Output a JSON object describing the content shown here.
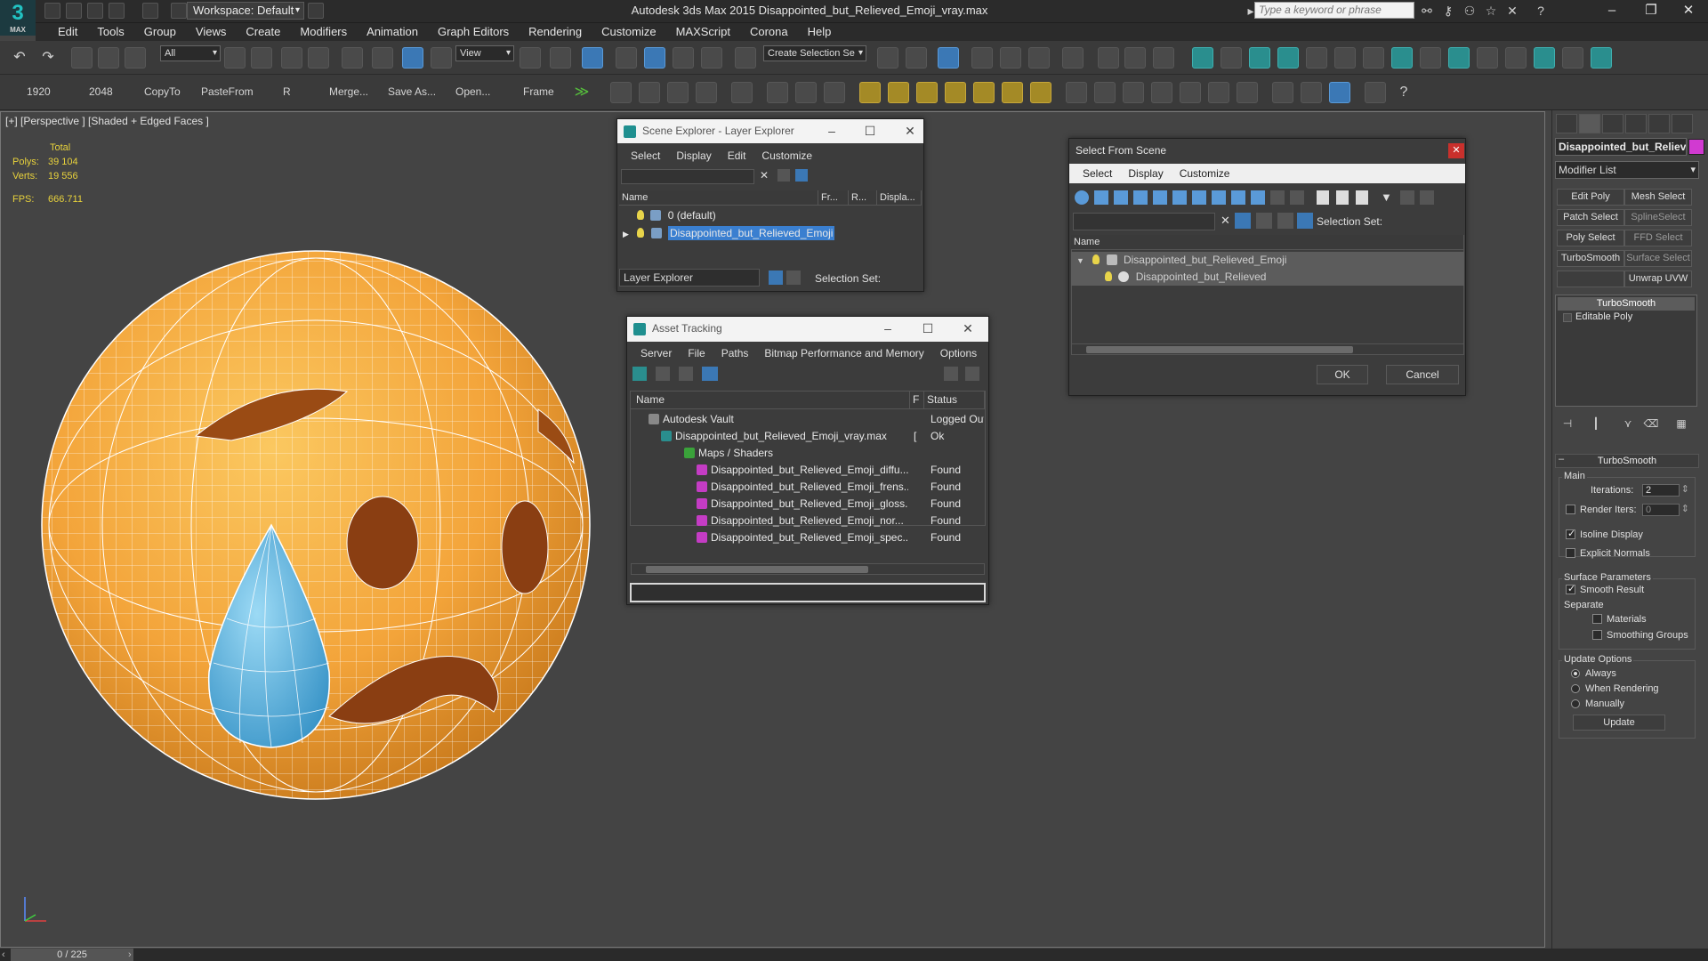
{
  "app": {
    "logo": "3",
    "logo_sub": "MAX",
    "window_title": "Autodesk 3ds Max  2015    Disappointed_but_Relieved_Emoji_vray.max",
    "workspace": "Workspace: Default",
    "search_placeholder": "Type a keyword or phrase"
  },
  "menu": [
    "Edit",
    "Tools",
    "Group",
    "Views",
    "Create",
    "Modifiers",
    "Animation",
    "Graph Editors",
    "Rendering",
    "Customize",
    "MAXScript",
    "Corona",
    "Help"
  ],
  "toolbar1": {
    "selection_filter": "All",
    "ref_coord": "View",
    "named_selection": "Create Selection Se"
  },
  "toolbar2": {
    "buttons": [
      "1920",
      "2048",
      "CopyTo",
      "PasteFrom",
      "R",
      "Merge...",
      "Save As...",
      "Open...",
      "Frame"
    ]
  },
  "viewport": {
    "label": "[+] [Perspective ] [Shaded + Edged Faces ]",
    "stats": {
      "header": "Total",
      "polys_label": "Polys:",
      "polys": "39 104",
      "verts_label": "Verts:",
      "verts": "19 556",
      "fps_label": "FPS:",
      "fps": "666.711"
    },
    "colors": {
      "emoji": "#f3a43a",
      "tear": "#5cb6e0",
      "wire": "#ffffff"
    }
  },
  "timeline": {
    "frame": "0 / 225"
  },
  "scene_explorer": {
    "title": "Scene Explorer - Layer Explorer",
    "menu": [
      "Select",
      "Display",
      "Edit",
      "Customize"
    ],
    "columns": [
      "Name",
      "Fr...",
      "R...",
      "Displa..."
    ],
    "rows": [
      "0 (default)",
      "Disappointed_but_Relieved_Emoji"
    ],
    "footer_dropdown": "Layer Explorer",
    "selection_set_label": "Selection Set:"
  },
  "select_from_scene": {
    "title": "Select From Scene",
    "menu": [
      "Select",
      "Display",
      "Customize"
    ],
    "selection_set_label": "Selection Set:",
    "column_name": "Name",
    "rows": [
      "Disappointed_but_Relieved_Emoji",
      "Disappointed_but_Relieved"
    ],
    "ok": "OK",
    "cancel": "Cancel"
  },
  "asset_tracking": {
    "title": "Asset Tracking",
    "menu": [
      "Server",
      "File",
      "Paths",
      "Bitmap Performance and Memory",
      "Options"
    ],
    "columns": [
      "Name",
      "F",
      "Status"
    ],
    "rows": [
      {
        "name": "Autodesk Vault",
        "f": "",
        "status": "Logged Out"
      },
      {
        "name": "Disappointed_but_Relieved_Emoji_vray.max",
        "f": "[",
        "status": "Ok"
      },
      {
        "name": "Maps / Shaders",
        "f": "",
        "status": ""
      },
      {
        "name": "Disappointed_but_Relieved_Emoji_diffu...",
        "f": "",
        "status": "Found"
      },
      {
        "name": "Disappointed_but_Relieved_Emoji_frens...",
        "f": "",
        "status": "Found"
      },
      {
        "name": "Disappointed_but_Relieved_Emoji_gloss...",
        "f": "",
        "status": "Found"
      },
      {
        "name": "Disappointed_but_Relieved_Emoji_nor...",
        "f": "",
        "status": "Found"
      },
      {
        "name": "Disappointed_but_Relieved_Emoji_spec...",
        "f": "",
        "status": "Found"
      }
    ]
  },
  "command_panel": {
    "object_name": "Disappointed_but_Reliev",
    "object_color": "#d13ad1",
    "modifier_list": "Modifier List",
    "mod_buttons": [
      "Edit Poly",
      "Mesh Select",
      "Patch Select",
      "SplineSelect",
      "Poly Select",
      "FFD Select",
      "TurboSmooth",
      "Surface Select",
      "",
      "Unwrap UVW"
    ],
    "stack": [
      "TurboSmooth",
      "Editable Poly"
    ],
    "rollout_title": "TurboSmooth",
    "main_group": "Main",
    "iterations_label": "Iterations:",
    "iterations_value": "2",
    "render_iters_label": "Render Iters:",
    "render_iters_value": "0",
    "isoline_display": "Isoline Display",
    "explicit_normals": "Explicit Normals",
    "surface_params": "Surface Parameters",
    "smooth_result": "Smooth Result",
    "separate": "Separate",
    "materials": "Materials",
    "smoothing_groups": "Smoothing Groups",
    "update_options": "Update Options",
    "always": "Always",
    "when_rendering": "When Rendering",
    "manually": "Manually",
    "update_button": "Update"
  }
}
